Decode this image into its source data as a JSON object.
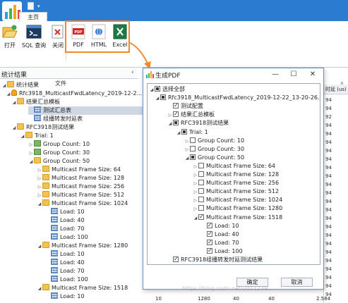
{
  "ribbon": {
    "tab_home": "主页",
    "buttons": {
      "open": "打开",
      "sql_query": "SQL 查询",
      "close": "关闭",
      "pdf": "PDF",
      "html": "HTML",
      "excel": "Excel"
    },
    "group_file": "文件",
    "pdf_icon_text": "PDF"
  },
  "left_panel": {
    "title": "统计结果",
    "collapse_arrow": "‹",
    "tree": [
      {
        "text": "统计结果",
        "icon": "folder-icon",
        "expander": "◢"
      },
      {
        "text": "Rfc3918_MulticastFwdLatency_2019-12-2...",
        "icon": "database-icon",
        "expander": "◢"
      },
      {
        "text": "结果汇总模板",
        "icon": "folder-icon",
        "expander": "◢"
      },
      {
        "text": "测试汇总表",
        "icon": "table-icon",
        "expander": ""
      },
      {
        "text": "组播转发时延表",
        "icon": "table-icon",
        "expander": ""
      },
      {
        "text": "RFC3918测试结果",
        "icon": "folder-icon",
        "expander": "◢"
      },
      {
        "text": "Trial: 1",
        "icon": "folder-icon",
        "expander": "◢"
      },
      {
        "text": "Group Count: 10",
        "icon": "group-icon",
        "expander": "▷"
      },
      {
        "text": "Group Count: 30",
        "icon": "group-icon",
        "expander": "▷"
      },
      {
        "text": "Group Count: 50",
        "icon": "folder-icon",
        "expander": "◢"
      },
      {
        "text": "Multicast Frame Size: 64",
        "icon": "folder-icon",
        "expander": "▷"
      },
      {
        "text": "Multicast Frame Size: 128",
        "icon": "folder-icon",
        "expander": "▷"
      },
      {
        "text": "Multicast Frame Size: 256",
        "icon": "folder-icon",
        "expander": "▷"
      },
      {
        "text": "Multicast Frame Size: 512",
        "icon": "folder-icon",
        "expander": "▷"
      },
      {
        "text": "Multicast Frame Size: 1024",
        "icon": "folder-icon",
        "expander": "◢"
      },
      {
        "text": "Load: 10",
        "icon": "table-icon",
        "expander": ""
      },
      {
        "text": "Load: 40",
        "icon": "table-icon",
        "expander": ""
      },
      {
        "text": "Load: 70",
        "icon": "table-icon",
        "expander": ""
      },
      {
        "text": "Load: 100",
        "icon": "table-icon",
        "expander": ""
      },
      {
        "text": "Multicast Frame Size: 1280",
        "icon": "folder-icon",
        "expander": "◢"
      },
      {
        "text": "Load: 10",
        "icon": "table-icon",
        "expander": ""
      },
      {
        "text": "Load: 40",
        "icon": "table-icon",
        "expander": ""
      },
      {
        "text": "Load: 70",
        "icon": "table-icon",
        "expander": ""
      },
      {
        "text": "Load: 100",
        "icon": "table-icon",
        "expander": ""
      },
      {
        "text": "Multicast Frame Size: 1518",
        "icon": "folder-icon",
        "expander": "◢"
      },
      {
        "text": "Load: 10",
        "icon": "table-icon",
        "expander": ""
      }
    ]
  },
  "dialog": {
    "title": "生成PDF",
    "minimize": "—",
    "maximize": "☐",
    "close": "✕",
    "tree": [
      {
        "text": "选择全部",
        "check": "partial",
        "expander": "◢"
      },
      {
        "text": "Rfc3918_MulticastFwdLatency_2019-12-22_13-20-26.db",
        "check": "partial",
        "expander": "◢"
      },
      {
        "text": "测试配置",
        "check": "checked",
        "expander": ""
      },
      {
        "text": "结果汇总模板",
        "check": "checked",
        "expander": "▷"
      },
      {
        "text": "RFC3918测试结果",
        "check": "partial",
        "expander": "◢"
      },
      {
        "text": "Trial: 1",
        "check": "partial",
        "expander": "◢"
      },
      {
        "text": "Group Count: 10",
        "check": "unchecked",
        "expander": "▷"
      },
      {
        "text": "Group Count: 30",
        "check": "unchecked",
        "expander": "▷"
      },
      {
        "text": "Group Count: 50",
        "check": "partial",
        "expander": "◢"
      },
      {
        "text": "Multicast Frame Size: 64",
        "check": "unchecked",
        "expander": "▷"
      },
      {
        "text": "Multicast Frame Size: 128",
        "check": "unchecked",
        "expander": "▷"
      },
      {
        "text": "Multicast Frame Size: 256",
        "check": "unchecked",
        "expander": "▷"
      },
      {
        "text": "Multicast Frame Size: 512",
        "check": "unchecked",
        "expander": "▷"
      },
      {
        "text": "Multicast Frame Size: 1024",
        "check": "unchecked",
        "expander": "▷"
      },
      {
        "text": "Multicast Frame Size: 1280",
        "check": "unchecked",
        "expander": "▷"
      },
      {
        "text": "Multicast Frame Size: 1518",
        "check": "checked",
        "expander": "◢"
      },
      {
        "text": "Load: 10",
        "check": "checked",
        "expander": ""
      },
      {
        "text": "Load: 40",
        "check": "checked",
        "expander": ""
      },
      {
        "text": "Load: 70",
        "check": "checked",
        "expander": ""
      },
      {
        "text": "Load: 100",
        "check": "checked",
        "expander": ""
      },
      {
        "text": "RFC3918组播转发时延测试结果",
        "check": "checked",
        "expander": ""
      }
    ],
    "ok": "确定",
    "cancel": "取消"
  },
  "background_grid": {
    "header": "时延 (us)",
    "cells": [
      "94",
      "94",
      "92",
      "94",
      "94",
      "94",
      "94",
      "94",
      "94",
      "94",
      "94",
      "94",
      "94",
      "94",
      "94",
      "94",
      "94",
      "94",
      "94",
      "94",
      "94",
      "94",
      "94",
      "94"
    ],
    "bottom_row": [
      "10",
      "1280",
      "40",
      "40",
      "2.584"
    ]
  },
  "watermark": "https://blog.csdn.net/u011239...",
  "colors": {
    "ribbon_blue": "#2b7bd0",
    "highlight_orange": "#f08a2c"
  }
}
